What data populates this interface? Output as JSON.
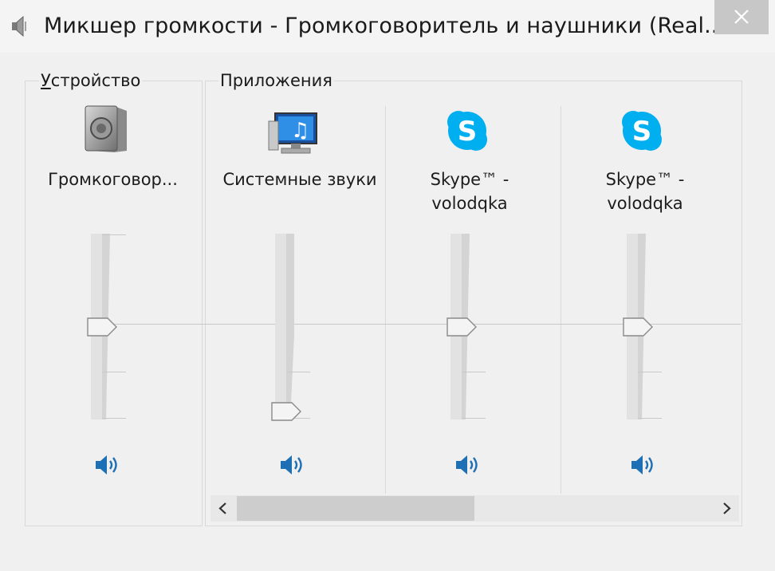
{
  "window": {
    "title": "Микшер громкости - Громкоговоритель и наушники (Real...",
    "close_symbol": "×"
  },
  "device": {
    "legend_text": "Устройство",
    "legend_first": "У",
    "legend_rest": "стройство",
    "channel": {
      "label": "Громкоговор...",
      "icon": "speaker-device-icon",
      "volume": 0.5
    }
  },
  "apps": {
    "legend_text": "Приложения",
    "channels": [
      {
        "label_line1": "Системные звуки",
        "label_line2": "",
        "icon": "monitor-music-icon",
        "volume": 0.0
      },
      {
        "label_line1": "Skype™ -",
        "label_line2": "volodqka",
        "icon": "skype-icon",
        "volume": 0.5
      },
      {
        "label_line1": "Skype™ -",
        "label_line2": "volodqka",
        "icon": "skype-icon",
        "volume": 0.5
      }
    ],
    "scroll_position": 0.0
  },
  "colors": {
    "skype_blue": "#00aff0",
    "speaker_icon_blue": "#1f6fb5",
    "close_button_bg": "#c7c7c7"
  }
}
